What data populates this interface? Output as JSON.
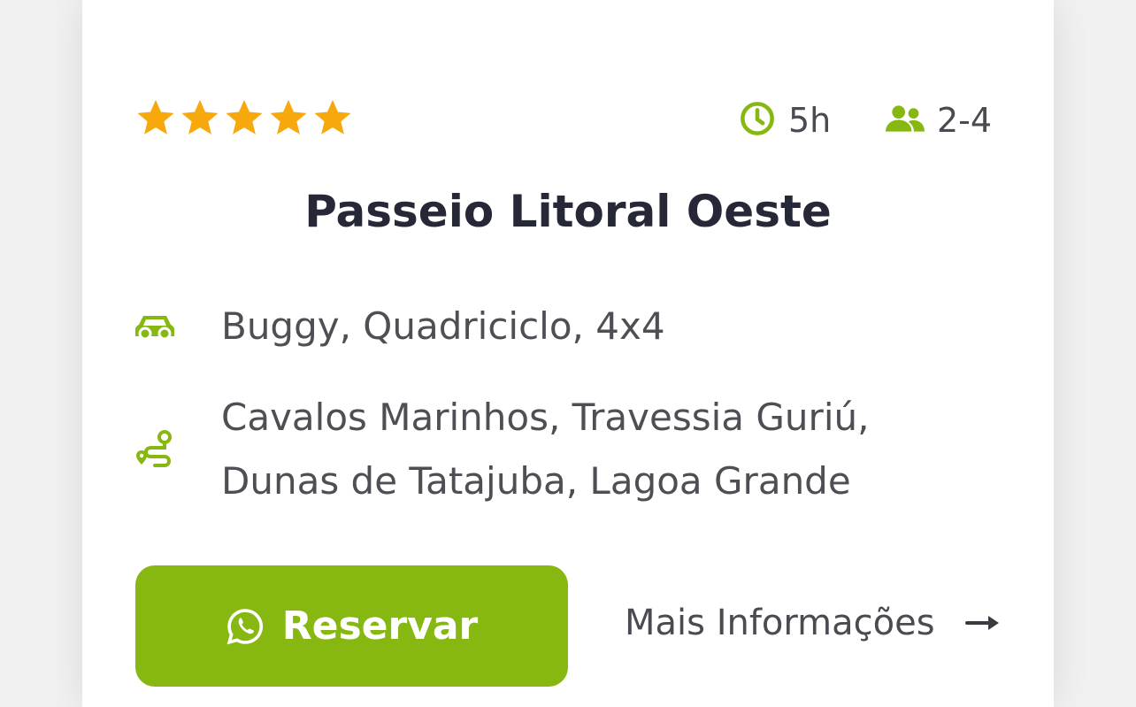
{
  "rating": {
    "stars": 5,
    "max": 5,
    "color": "#f7a80d"
  },
  "duration": {
    "value": "5h",
    "icon": "clock-icon"
  },
  "group_size": {
    "value": "2-4",
    "icon": "users-icon"
  },
  "tour": {
    "title": "Passeio Litoral Oeste"
  },
  "vehicles": {
    "icon": "car-icon",
    "text": "Buggy, Quadriciclo, 4x4"
  },
  "route": {
    "icon": "route-icon",
    "lines": [
      "Cavalos Marinhos, Travessia Guriú,",
      "Dunas de Tatajuba, Lagoa Grande"
    ]
  },
  "actions": {
    "reserve_label": "Reservar",
    "reserve_icon": "whatsapp-icon",
    "more_info_label": "Mais Informações",
    "more_info_icon": "arrow-right-icon"
  },
  "colors": {
    "accent": "#86b811",
    "star": "#f7a80d",
    "title": "#262838",
    "text": "#4e4e55"
  }
}
